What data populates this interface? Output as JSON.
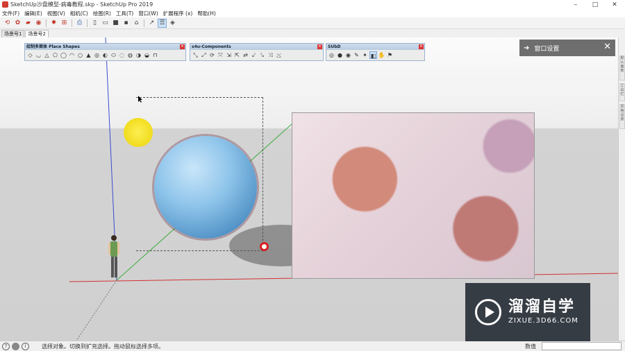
{
  "window": {
    "title": "SketchUp沙盘模型-病毒教程.skp - SketchUp Pro 2019",
    "controls": [
      "–",
      "□",
      "✕"
    ]
  },
  "menu": [
    "文件(F)",
    "编辑(E)",
    "视图(V)",
    "相机(C)",
    "绘图(R)",
    "工具(T)",
    "窗口(W)",
    "扩展程序 (x)",
    "帮助(H)"
  ],
  "toolbar": {
    "icons": [
      "select-tool",
      "eraser-tool",
      "paint-tool",
      "record-tool",
      "gear-tool",
      "component-tool",
      "print-tool",
      "section-tool",
      "face-tool",
      "fill-tool",
      "pin-tool",
      "save-tool",
      "arrow-tool",
      "layout-tool",
      "xray-tool"
    ]
  },
  "scene_tabs": [
    "场景号1",
    "场景号2"
  ],
  "floating_toolbars": [
    {
      "title": "绘制多面体 Place Shapes",
      "icon_count": 19
    },
    {
      "title": "s4u-Components",
      "icon_count": 11
    },
    {
      "title": "SUbD",
      "icon_count": 8
    }
  ],
  "window_panel": {
    "label": "窗口设置"
  },
  "right_tabs": [
    "默认面板",
    "工具栏",
    "风格设置"
  ],
  "status": {
    "text": "选择对象。切换到扩充选择。拖动鼠标选择多项。",
    "vcb_label": "数值",
    "vcb_value": ""
  },
  "watermark": {
    "name": "溜溜自学",
    "url": "ZIXUE.3D66.COM"
  }
}
